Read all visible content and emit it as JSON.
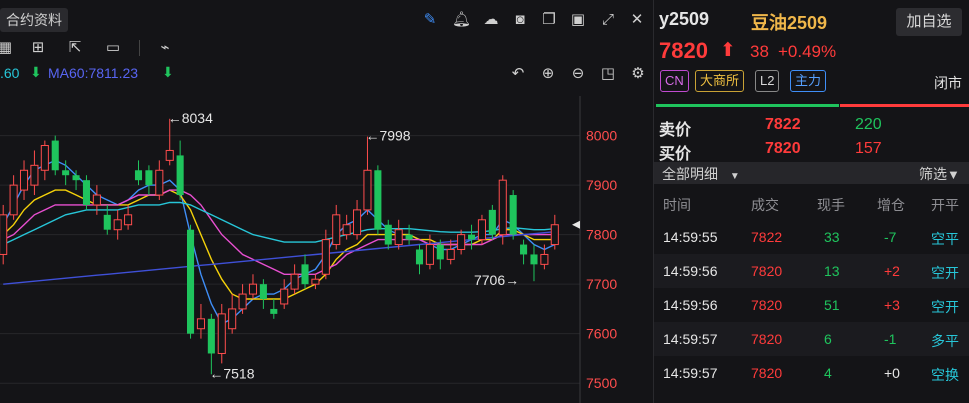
{
  "toolbar": {
    "contract_info_label": "合约资料"
  },
  "ma": {
    "prev_value": ".60",
    "ma60_label": "MA60:7811.23"
  },
  "chart": {
    "y_ticks": [
      "8000",
      "7900",
      "7800",
      "7700",
      "7600",
      "7500"
    ],
    "annotations": {
      "high1": "←8034",
      "high2": "←7998",
      "low1": "←7518",
      "low2": "7706→"
    }
  },
  "chart_data": {
    "type": "candlestick",
    "ylim": [
      7460,
      8080
    ],
    "y_ticks": [
      8000,
      7900,
      7800,
      7700,
      7600,
      7500
    ],
    "candles": [
      {
        "o": 7760,
        "c": 7840,
        "h": 7860,
        "l": 7740
      },
      {
        "o": 7840,
        "c": 7900,
        "h": 7920,
        "l": 7830
      },
      {
        "o": 7890,
        "c": 7930,
        "h": 7950,
        "l": 7870
      },
      {
        "o": 7900,
        "c": 7940,
        "h": 7970,
        "l": 7880
      },
      {
        "o": 7930,
        "c": 7980,
        "h": 7990,
        "l": 7910
      },
      {
        "o": 7990,
        "c": 7930,
        "h": 8000,
        "l": 7920
      },
      {
        "o": 7930,
        "c": 7920,
        "h": 7950,
        "l": 7900
      },
      {
        "o": 7920,
        "c": 7910,
        "h": 7930,
        "l": 7890
      },
      {
        "o": 7910,
        "c": 7860,
        "h": 7920,
        "l": 7850
      },
      {
        "o": 7860,
        "c": 7880,
        "h": 7900,
        "l": 7840
      },
      {
        "o": 7840,
        "c": 7810,
        "h": 7860,
        "l": 7800
      },
      {
        "o": 7810,
        "c": 7830,
        "h": 7850,
        "l": 7790
      },
      {
        "o": 7820,
        "c": 7840,
        "h": 7860,
        "l": 7810
      },
      {
        "o": 7930,
        "c": 7910,
        "h": 7950,
        "l": 7900
      },
      {
        "o": 7930,
        "c": 7900,
        "h": 7940,
        "l": 7880
      },
      {
        "o": 7880,
        "c": 7930,
        "h": 7950,
        "l": 7870
      },
      {
        "o": 7950,
        "c": 7970,
        "h": 8034,
        "l": 7940
      },
      {
        "o": 7960,
        "c": 7880,
        "h": 7990,
        "l": 7870
      },
      {
        "o": 7810,
        "c": 7600,
        "h": 7820,
        "l": 7590
      },
      {
        "o": 7610,
        "c": 7630,
        "h": 7660,
        "l": 7590
      },
      {
        "o": 7630,
        "c": 7560,
        "h": 7640,
        "l": 7518
      },
      {
        "o": 7560,
        "c": 7640,
        "h": 7660,
        "l": 7540
      },
      {
        "o": 7610,
        "c": 7650,
        "h": 7680,
        "l": 7600
      },
      {
        "o": 7650,
        "c": 7680,
        "h": 7700,
        "l": 7640
      },
      {
        "o": 7680,
        "c": 7700,
        "h": 7720,
        "l": 7670
      },
      {
        "o": 7700,
        "c": 7670,
        "h": 7710,
        "l": 7650
      },
      {
        "o": 7650,
        "c": 7640,
        "h": 7670,
        "l": 7630
      },
      {
        "o": 7660,
        "c": 7690,
        "h": 7710,
        "l": 7650
      },
      {
        "o": 7690,
        "c": 7720,
        "h": 7740,
        "l": 7680
      },
      {
        "o": 7740,
        "c": 7700,
        "h": 7760,
        "l": 7690
      },
      {
        "o": 7700,
        "c": 7710,
        "h": 7720,
        "l": 7690
      },
      {
        "o": 7720,
        "c": 7790,
        "h": 7810,
        "l": 7710
      },
      {
        "o": 7780,
        "c": 7840,
        "h": 7860,
        "l": 7770
      },
      {
        "o": 7800,
        "c": 7820,
        "h": 7840,
        "l": 7790
      },
      {
        "o": 7800,
        "c": 7850,
        "h": 7870,
        "l": 7790
      },
      {
        "o": 7850,
        "c": 7930,
        "h": 7998,
        "l": 7840
      },
      {
        "o": 7930,
        "c": 7810,
        "h": 7940,
        "l": 7800
      },
      {
        "o": 7820,
        "c": 7780,
        "h": 7830,
        "l": 7770
      },
      {
        "o": 7780,
        "c": 7810,
        "h": 7830,
        "l": 7770
      },
      {
        "o": 7800,
        "c": 7790,
        "h": 7820,
        "l": 7780
      },
      {
        "o": 7770,
        "c": 7740,
        "h": 7780,
        "l": 7720
      },
      {
        "o": 7740,
        "c": 7780,
        "h": 7800,
        "l": 7730
      },
      {
        "o": 7780,
        "c": 7750,
        "h": 7790,
        "l": 7730
      },
      {
        "o": 7750,
        "c": 7770,
        "h": 7790,
        "l": 7740
      },
      {
        "o": 7770,
        "c": 7800,
        "h": 7810,
        "l": 7760
      },
      {
        "o": 7800,
        "c": 7790,
        "h": 7820,
        "l": 7770
      },
      {
        "o": 7790,
        "c": 7830,
        "h": 7840,
        "l": 7780
      },
      {
        "o": 7850,
        "c": 7800,
        "h": 7860,
        "l": 7790
      },
      {
        "o": 7800,
        "c": 7910,
        "h": 7920,
        "l": 7780
      },
      {
        "o": 7880,
        "c": 7800,
        "h": 7890,
        "l": 7790
      },
      {
        "o": 7780,
        "c": 7760,
        "h": 7790,
        "l": 7740
      },
      {
        "o": 7760,
        "c": 7740,
        "h": 7780,
        "l": 7706
      },
      {
        "o": 7740,
        "c": 7760,
        "h": 7780,
        "l": 7730
      },
      {
        "o": 7780,
        "c": 7820,
        "h": 7840,
        "l": 7770
      }
    ],
    "series": [
      {
        "color": "#3f8ef7",
        "values": [
          7820,
          7860,
          7900,
          7930,
          7940,
          7950,
          7940,
          7920,
          7900,
          7880,
          7870,
          7860,
          7870,
          7890,
          7900,
          7900,
          7910,
          7890,
          7800,
          7720,
          7660,
          7620,
          7630,
          7650,
          7670,
          7680,
          7680,
          7690,
          7710,
          7720,
          7730,
          7760,
          7800,
          7820,
          7830,
          7850,
          7830,
          7810,
          7800,
          7800,
          7790,
          7780,
          7770,
          7770,
          7780,
          7790,
          7800,
          7800,
          7830,
          7820,
          7800,
          7780,
          7770,
          7780
        ]
      },
      {
        "color": "#f5d20a",
        "values": [
          7800,
          7820,
          7850,
          7870,
          7880,
          7890,
          7890,
          7880,
          7870,
          7860,
          7860,
          7860,
          7860,
          7870,
          7880,
          7880,
          7890,
          7880,
          7850,
          7800,
          7750,
          7710,
          7680,
          7670,
          7670,
          7670,
          7670,
          7670,
          7680,
          7690,
          7700,
          7720,
          7750,
          7770,
          7780,
          7800,
          7800,
          7800,
          7800,
          7800,
          7790,
          7790,
          7780,
          7780,
          7780,
          7780,
          7790,
          7790,
          7810,
          7810,
          7800,
          7790,
          7790,
          7790
        ]
      },
      {
        "color": "#e84fd0",
        "values": [
          7790,
          7800,
          7820,
          7840,
          7850,
          7860,
          7860,
          7860,
          7860,
          7860,
          7860,
          7860,
          7870,
          7880,
          7880,
          7880,
          7890,
          7890,
          7880,
          7860,
          7830,
          7800,
          7780,
          7760,
          7750,
          7740,
          7730,
          7720,
          7720,
          7720,
          7720,
          7730,
          7740,
          7760,
          7770,
          7780,
          7790,
          7790,
          7790,
          7790,
          7790,
          7780,
          7780,
          7780,
          7780,
          7780,
          7780,
          7790,
          7800,
          7800,
          7800,
          7800,
          7800,
          7800
        ]
      },
      {
        "color": "#27c6d8",
        "values": [
          7780,
          7790,
          7800,
          7810,
          7820,
          7830,
          7840,
          7845,
          7850,
          7850,
          7850,
          7850,
          7855,
          7860,
          7860,
          7860,
          7865,
          7865,
          7860,
          7850,
          7840,
          7830,
          7820,
          7810,
          7800,
          7795,
          7790,
          7785,
          7785,
          7785,
          7785,
          7790,
          7795,
          7800,
          7805,
          7810,
          7812,
          7812,
          7812,
          7812,
          7810,
          7808,
          7806,
          7805,
          7805,
          7805,
          7806,
          7808,
          7812,
          7814,
          7812,
          7810,
          7810,
          7812
        ]
      },
      {
        "color": "#3f50d8",
        "values": [
          7700,
          7702,
          7704,
          7706,
          7708,
          7710,
          7712,
          7714,
          7716,
          7718,
          7720,
          7722,
          7724,
          7726,
          7728,
          7730,
          7732,
          7734,
          7736,
          7738,
          7740,
          7742,
          7744,
          7746,
          7748,
          7750,
          7752,
          7754,
          7756,
          7758,
          7760,
          7762,
          7764,
          7766,
          7768,
          7770,
          7772,
          7774,
          7776,
          7778,
          7780,
          7782,
          7784,
          7786,
          7788,
          7790,
          7792,
          7794,
          7796,
          7798,
          7800,
          7802,
          7804,
          7806
        ]
      }
    ]
  },
  "quote": {
    "code": "y2509",
    "name": "豆油2509",
    "add_watch": "加自选",
    "price": "7820",
    "change": "38",
    "change_pct": "+0.49%",
    "tags": [
      "CN",
      "大商所",
      "L2",
      "主力"
    ],
    "status": "闭市",
    "ask_label": "卖价",
    "ask_price": "7822",
    "ask_vol": "220",
    "bid_label": "买价",
    "bid_price": "7820",
    "bid_vol": "157"
  },
  "trades": {
    "filter_all": "全部明细",
    "filter_btn": "筛选",
    "headers": [
      "时间",
      "成交",
      "现手",
      "增仓",
      "开平"
    ],
    "rows": [
      {
        "time": "14:59:55",
        "price": "7822",
        "vol": "33",
        "oi": "-7",
        "type": "空平"
      },
      {
        "time": "14:59:56",
        "price": "7820",
        "vol": "13",
        "oi": "+2",
        "type": "空开"
      },
      {
        "time": "14:59:56",
        "price": "7820",
        "vol": "51",
        "oi": "+3",
        "type": "空开"
      },
      {
        "time": "14:59:57",
        "price": "7820",
        "vol": "6",
        "oi": "-1",
        "type": "多平"
      },
      {
        "time": "14:59:57",
        "price": "7820",
        "vol": "4",
        "oi": "+0",
        "type": "空换"
      }
    ]
  }
}
